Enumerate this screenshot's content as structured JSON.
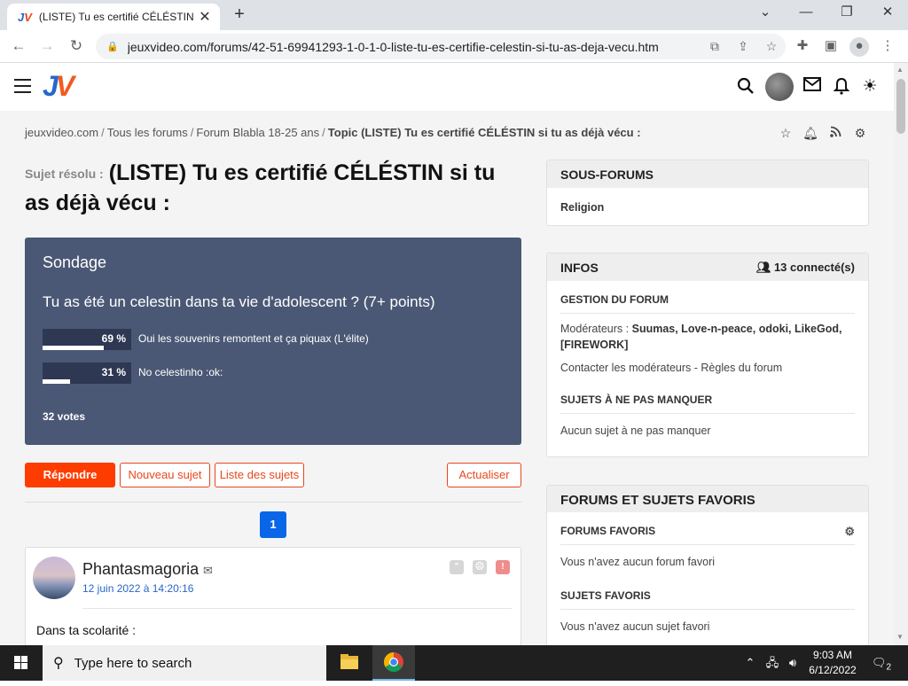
{
  "browser": {
    "tab_title": "(LISTE) Tu es certifié CÉLÉSTIN si",
    "url": "jeuxvideo.com/forums/42-51-69941293-1-0-1-0-liste-tu-es-certifie-celestin-si-tu-as-deja-vecu.htm"
  },
  "header": {
    "logo_j": "J",
    "logo_v": "V"
  },
  "breadcrumb": {
    "items": [
      "jeuxvideo.com",
      "Tous les forums",
      "Forum Blabla 18-25 ans"
    ],
    "separator": "/",
    "current": "Topic (LISTE) Tu es certifié CÉLÉSTIN si tu as déjà vécu :"
  },
  "topic": {
    "prefix": "Sujet résolu :",
    "title": "(LISTE) Tu es certifié CÉLÉSTIN si tu as déjà vécu :"
  },
  "poll": {
    "heading": "Sondage",
    "question": "Tu as été un celestin dans ta vie d'adolescent ? (7+ points)",
    "options": [
      {
        "pct_label": "69 %",
        "percent": 69,
        "label": "Oui les souvenirs remontent et ça piquax (L'élite)"
      },
      {
        "pct_label": "31 %",
        "percent": 31,
        "label": "No celestinho :ok:"
      }
    ],
    "votes": "32 votes"
  },
  "actions": {
    "reply": "Répondre",
    "new_topic": "Nouveau sujet",
    "list_topics": "Liste des sujets",
    "refresh": "Actualiser"
  },
  "pagination": {
    "current": "1"
  },
  "post": {
    "author": "Phantasmagoria",
    "date": "12 juin 2022 à 14:20:16",
    "body": "Dans ta scolarité :"
  },
  "sidebar": {
    "subforums": {
      "title": "SOUS-FORUMS",
      "item": "Religion"
    },
    "infos": {
      "title": "INFOS",
      "connected": "13 connecté(s)",
      "gestion_title": "GESTION DU FORUM",
      "moderators_label": "Modérateurs :",
      "moderators": "Suumas, Love-n-peace, odoki, LikeGod, [FIREWORK]",
      "contact": "Contacter les modérateurs",
      "dash": " - ",
      "rules": "Règles du forum",
      "must_read_title": "SUJETS À NE PAS MANQUER",
      "must_read_empty": "Aucun sujet à ne pas manquer"
    },
    "favorites": {
      "title": "FORUMS ET SUJETS FAVORIS",
      "forums_title": "FORUMS FAVORIS",
      "forums_empty": "Vous n'avez aucun forum favori",
      "topics_title": "SUJETS FAVORIS",
      "topics_empty": "Vous n'avez aucun sujet favori"
    }
  },
  "taskbar": {
    "search_placeholder": "Type here to search",
    "time": "9:03 AM",
    "date": "6/12/2022",
    "notification_count": "2"
  }
}
